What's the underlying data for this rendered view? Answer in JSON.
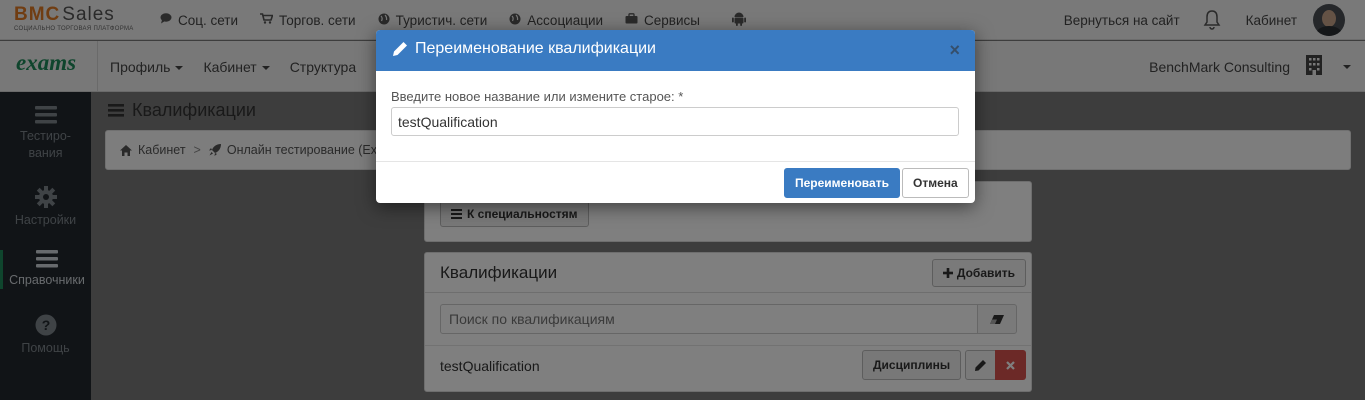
{
  "logo": {
    "main": "BMC",
    "second": "Sales",
    "subtitle": "Социально торговая платформа"
  },
  "topnav": {
    "items": [
      {
        "label": "Соц. сети",
        "icon": "comment-icon"
      },
      {
        "label": "Торгов. сети",
        "icon": "cart-icon"
      },
      {
        "label": "Туристич. сети",
        "icon": "globe-icon"
      },
      {
        "label": "Ассоциации",
        "icon": "globe-icon"
      },
      {
        "label": "Сервисы",
        "icon": "briefcase-icon"
      }
    ],
    "android_icon": "android-icon"
  },
  "topright": {
    "back_to_site": "Вернуться на сайт",
    "cabinet": "Кабинет"
  },
  "navbar2": {
    "brand": "exams",
    "items": [
      {
        "label": "Профиль",
        "dropdown": true
      },
      {
        "label": "Кабинет",
        "dropdown": true
      },
      {
        "label": "Структура",
        "dropdown": false
      }
    ],
    "company": "BenchMark Consulting"
  },
  "sidebar": {
    "items": [
      {
        "label": "Тестиро-\nвания",
        "icon": "bars-icon"
      },
      {
        "label": "Настройки",
        "icon": "gear-icon"
      },
      {
        "label": "Справочники",
        "icon": "bars-icon",
        "active": true
      },
      {
        "label": "Помощь",
        "icon": "question-icon"
      }
    ]
  },
  "page": {
    "title": "Квалификации",
    "breadcrumb": [
      "Кабинет",
      "Онлайн тестирование (Exam"
    ],
    "to_specialties": "К специальностям",
    "panel_title": "Квалификации",
    "add_label": "Добавить",
    "search_placeholder": "Поиск по квалификациям",
    "row": {
      "name": "testQualification",
      "disciplines": "Дисциплины"
    }
  },
  "modal": {
    "title": "Переименование квалификации",
    "close": "×",
    "label": "Введите новое название или измените старое: *",
    "input_value": "testQualification",
    "rename": "Переименовать",
    "cancel": "Отмена"
  },
  "colors": {
    "accent": "#3a7bc2",
    "brand_green": "#1f8a5b",
    "logo_orange": "#e07a24",
    "danger": "#d9534f",
    "sidebar": "#23292e"
  }
}
